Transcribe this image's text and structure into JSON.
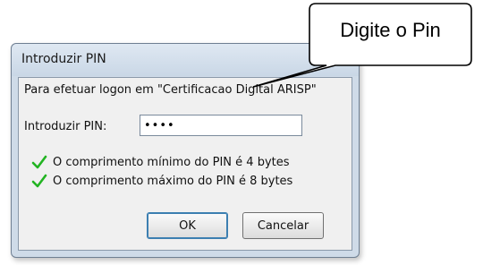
{
  "window": {
    "title": "Introduzir PIN",
    "message": "Para efetuar logon em \"Certificacao Digital ARISP\""
  },
  "pin": {
    "label": "Introduzir PIN:",
    "value": "••••"
  },
  "requirements": [
    {
      "text": "O comprimento mínimo do PIN é 4 bytes",
      "icon": "check-icon"
    },
    {
      "text": "O comprimento máximo do PIN é 8 bytes",
      "icon": "check-icon"
    }
  ],
  "buttons": {
    "ok": "OK",
    "cancel": "Cancelar"
  },
  "callout": {
    "text": "Digite o Pin"
  },
  "colors": {
    "check": "#22b422",
    "window_frame": "#cfdbe8",
    "client_bg": "#f0f0f0",
    "default_button_border": "#3c7fb1"
  }
}
